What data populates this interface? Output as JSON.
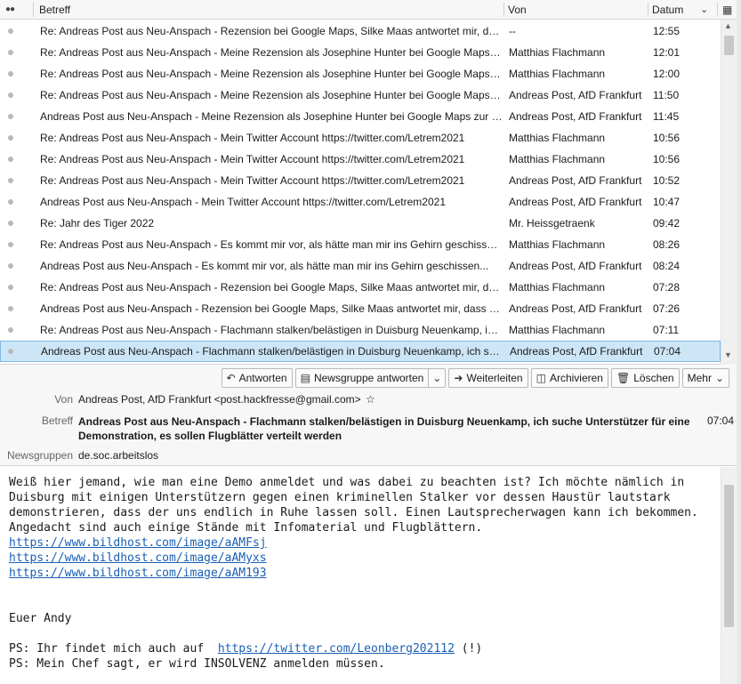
{
  "list": {
    "columns": {
      "subject": "Betreff",
      "from": "Von",
      "date": "Datum"
    },
    "rows": [
      {
        "subject": "Re: Andreas Post aus Neu-Anspach - Rezension bei Google Maps, Silke Maas antwortet mir, dass es ...",
        "from": "--",
        "date": "12:55"
      },
      {
        "subject": "Re: Andreas Post aus Neu-Anspach - Meine Rezension als Josephine Hunter bei Google Maps zur Eis...",
        "from": "Matthias Flachmann",
        "date": "12:01"
      },
      {
        "subject": "Re: Andreas Post aus Neu-Anspach - Meine Rezension als Josephine Hunter bei Google Maps zur Eis...",
        "from": "Matthias Flachmann",
        "date": "12:00"
      },
      {
        "subject": "Re: Andreas Post aus Neu-Anspach - Meine Rezension als Josephine Hunter bei Google Maps zur Eis...",
        "from": "Andreas Post, AfD Frankfurt",
        "date": "11:50"
      },
      {
        "subject": "Andreas Post aus Neu-Anspach - Meine Rezension als Josephine Hunter bei Google Maps zur Eis...",
        "from": "Andreas Post, AfD Frankfurt",
        "date": "11:45"
      },
      {
        "subject": "Re: Andreas Post aus Neu-Anspach - Mein Twitter Account https://twitter.com/Letrem2021",
        "from": "Matthias Flachmann",
        "date": "10:56"
      },
      {
        "subject": "Re: Andreas Post aus Neu-Anspach - Mein Twitter Account https://twitter.com/Letrem2021",
        "from": "Matthias Flachmann",
        "date": "10:56"
      },
      {
        "subject": "Re: Andreas Post aus Neu-Anspach - Mein Twitter Account https://twitter.com/Letrem2021",
        "from": "Andreas Post, AfD Frankfurt",
        "date": "10:52"
      },
      {
        "subject": "Andreas Post aus Neu-Anspach  -  Mein Twitter Account https://twitter.com/Letrem2021",
        "from": "Andreas Post, AfD Frankfurt",
        "date": "10:47"
      },
      {
        "subject": "Re: Jahr des Tiger 2022",
        "from": "Mr. Heissgetraenk",
        "date": "09:42"
      },
      {
        "subject": "Re: Andreas Post aus Neu-Anspach - Es kommt mir vor, als hätte man mir ins Gehirn geschissen...",
        "from": "Matthias Flachmann",
        "date": "08:26"
      },
      {
        "subject": "Andreas Post aus Neu-Anspach  -  Es kommt mir vor, als hätte man mir ins Gehirn geschissen...",
        "from": "Andreas Post, AfD Frankfurt",
        "date": "08:24"
      },
      {
        "subject": "Re: Andreas Post aus Neu-Anspach - Rezension bei Google Maps, Silke Maas antwortet mir, dass es ...",
        "from": "Matthias Flachmann",
        "date": "07:28"
      },
      {
        "subject": "Andreas Post aus Neu-Anspach  -  Rezension bei Google Maps, Silke Maas antwortet mir, dass es ...",
        "from": "Andreas Post, AfD Frankfurt",
        "date": "07:26"
      },
      {
        "subject": "Re: Andreas Post aus Neu-Anspach - Flachmann stalken/belästigen in Duisburg Neuenkamp, ich su...",
        "from": "Matthias Flachmann",
        "date": "07:11"
      },
      {
        "subject": "Andreas Post aus Neu-Anspach  -  Flachmann stalken/belästigen in Duisburg Neuenkamp,  ich such...",
        "from": "Andreas Post, AfD Frankfurt",
        "date": "07:04",
        "selected": true
      }
    ]
  },
  "toolbar": {
    "reply": "Antworten",
    "reply_newsgroup": "Newsgruppe antworten",
    "forward": "Weiterleiten",
    "archive": "Archivieren",
    "delete": "Löschen",
    "more": "Mehr"
  },
  "message": {
    "from_label": "Von",
    "from_value": "Andreas Post, AfD Frankfurt <post.hackfresse@gmail.com>",
    "subject_label": "Betreff",
    "subject_value": "Andreas Post aus Neu-Anspach - Flachmann stalken/belästigen in Duisburg Neuenkamp, ich suche Unterstützer für eine Demonstration, es sollen Flugblätter verteilt werden",
    "time": "07:04",
    "newsgroups_label": "Newsgruppen",
    "newsgroups_value": "de.soc.arbeitslos"
  },
  "body": {
    "line1": "Weiß hier jemand, wie man eine Demo anmeldet und was dabei zu beachten ist? Ich möchte nämlich in",
    "line2": "Duisburg mit einigen Unterstützern gegen einen kriminellen Stalker vor dessen Haustür lautstark",
    "line3": "demonstrieren, dass der uns endlich in Ruhe lassen soll. Einen Lautsprecherwagen kann ich bekommen.",
    "line4": "Angedacht sind auch einige Stände mit Infomaterial und Flugblättern.",
    "link1": "https://www.bildhost.com/image/aAMFsj",
    "link2": "https://www.bildhost.com/image/aAMyxs",
    "link3": "https://www.bildhost.com/image/aAM193",
    "signature": "Euer Andy",
    "ps1_prefix": "PS: Ihr findet mich auch auf  ",
    "ps1_link": "https://twitter.com/Leonberg202112",
    "ps1_suffix": " (!)",
    "ps2": "PS: Mein Chef sagt, er wird INSOLVENZ anmelden müssen."
  }
}
